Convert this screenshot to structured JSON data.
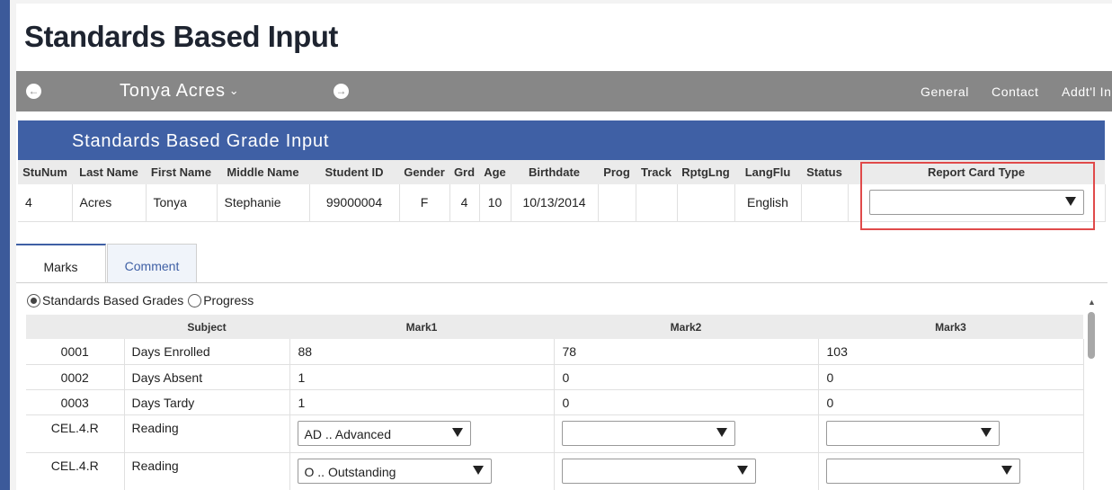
{
  "page": {
    "title": "Standards Based Input"
  },
  "navbar": {
    "prev_label": "←",
    "next_label": "→",
    "student_name": "Tonya Acres",
    "links": [
      "General",
      "Contact",
      "Addt'l In"
    ]
  },
  "section": {
    "title": "Standards Based Grade Input"
  },
  "student_table": {
    "headers": [
      "StuNum",
      "Last Name",
      "First Name",
      "Middle Name",
      "Student ID",
      "Gender",
      "Grd",
      "Age",
      "Birthdate",
      "Prog",
      "Track",
      "RptgLng",
      "LangFlu",
      "Status",
      "Report Card Type"
    ],
    "row": [
      "4",
      "Acres",
      "Tonya",
      "Stephanie",
      "99000004",
      "F",
      "4",
      "10",
      "10/13/2014",
      "",
      "",
      "",
      "English",
      ""
    ],
    "report_card_type_value": ""
  },
  "tabs": [
    "Marks",
    "Comment"
  ],
  "radios": {
    "option1": "Standards Based Grades",
    "option2": "Progress"
  },
  "marks_table": {
    "headers": [
      "",
      "Subject",
      "Mark1",
      "Mark2",
      "Mark3"
    ],
    "rows": [
      {
        "code": "0001",
        "subject": "Days Enrolled",
        "m1": "88",
        "m2": "78",
        "m3": "103"
      },
      {
        "code": "0002",
        "subject": "Days Absent",
        "m1": "1",
        "m2": "0",
        "m3": "0"
      },
      {
        "code": "0003",
        "subject": "Days Tardy",
        "m1": "1",
        "m2": "0",
        "m3": "0"
      },
      {
        "code": "CEL.4.R",
        "subject": "Reading",
        "m1": "AD .. Advanced",
        "m2": "",
        "m3": ""
      },
      {
        "code": "CEL.4.R",
        "subject": "Reading",
        "m1": "O .. Outstanding",
        "m2": "",
        "m3": ""
      }
    ]
  },
  "colors": {
    "brand_blue": "#3f60a5",
    "nav_gray": "#878787",
    "highlight_red": "#e04a4a"
  }
}
